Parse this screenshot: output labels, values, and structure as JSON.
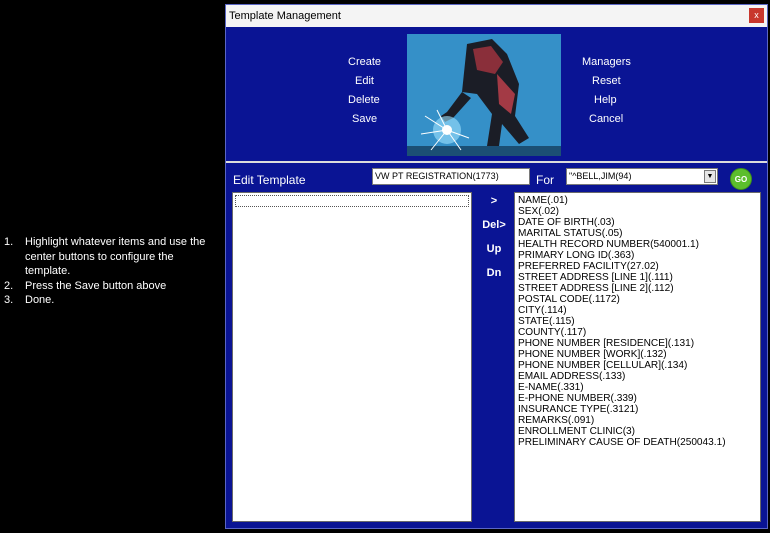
{
  "instructions": [
    {
      "num": "1.",
      "text": "Highlight whatever items and use the center buttons to configure the template."
    },
    {
      "num": "2.",
      "text": "Press the Save button above"
    },
    {
      "num": "3.",
      "text": "Done."
    }
  ],
  "window": {
    "title": "Template Management",
    "close_label": "x"
  },
  "menu": {
    "left": [
      "Create",
      "Edit",
      "Delete",
      "Save"
    ],
    "right": [
      "Managers",
      "Reset",
      "Help",
      "Cancel"
    ]
  },
  "edit": {
    "label": "Edit Template",
    "template_value": "VW PT REGISTRATION(1773)",
    "for_label": "For",
    "for_value": "\"^BELL,JIM(94)",
    "go_label": "GO"
  },
  "controls": {
    "add": ">",
    "delete": "Del>",
    "up": "Up",
    "down": "Dn"
  },
  "fields": [
    "NAME(.01)",
    "SEX(.02)",
    "DATE OF BIRTH(.03)",
    "MARITAL STATUS(.05)",
    "HEALTH RECORD NUMBER(540001.1)",
    "PRIMARY LONG ID(.363)",
    "PREFERRED FACILITY(27.02)",
    "STREET ADDRESS [LINE 1](.111)",
    "STREET ADDRESS [LINE 2](.112)",
    "POSTAL CODE(.1172)",
    "CITY(.114)",
    "STATE(.115)",
    "COUNTY(.117)",
    "PHONE NUMBER [RESIDENCE](.131)",
    "PHONE NUMBER [WORK](.132)",
    "PHONE NUMBER [CELLULAR](.134)",
    "EMAIL ADDRESS(.133)",
    "E-NAME(.331)",
    "E-PHONE NUMBER(.339)",
    "INSURANCE TYPE(.3121)",
    "REMARKS(.091)",
    "ENROLLMENT CLINIC(3)",
    "PRELIMINARY CAUSE OF DEATH(250043.1)"
  ],
  "colors": {
    "window_bg": "#0a1494",
    "go": "#5cbe2c",
    "close": "#c8372d"
  }
}
